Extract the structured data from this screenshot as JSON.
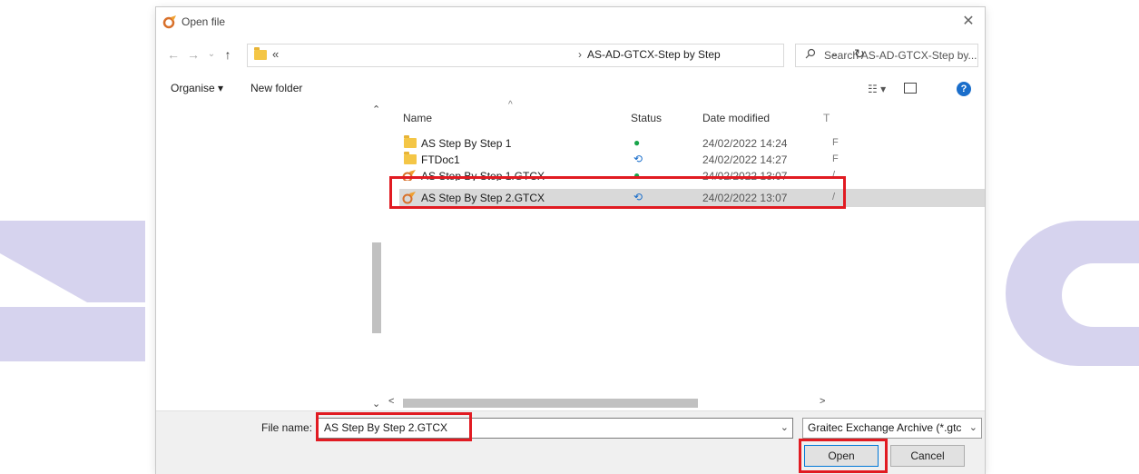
{
  "window": {
    "title": "Open file",
    "close_symbol": "✕"
  },
  "nav": {
    "back": "←",
    "forward": "→",
    "recent": "⌄",
    "up": "↑"
  },
  "address": {
    "overflow_symbol": "«",
    "separator": "›",
    "path": "AS-AD-GTCX-Step by Step",
    "dropdown_symbol": "⌄",
    "refresh_symbol": "↻"
  },
  "search": {
    "placeholder": "Search AS-AD-GTCX-Step by..."
  },
  "toolbar": {
    "organise_label": "Organise ▾",
    "new_folder_label": "New folder",
    "view_symbol": "☷ ▾",
    "help_symbol": "?"
  },
  "columns": {
    "name": "Name",
    "status": "Status",
    "date": "Date modified",
    "more": "T"
  },
  "files": [
    {
      "name": "AS Step By Step 1",
      "type": "folder",
      "status": "ok",
      "date": "24/02/2022 14:24",
      "extra": "F"
    },
    {
      "name": "FTDoc1",
      "type": "folder",
      "status": "sync",
      "date": "24/02/2022 14:27",
      "extra": "F"
    },
    {
      "name": "AS Step By Step 1.GTCX",
      "type": "gtcx",
      "status": "ok",
      "date": "24/02/2022 13:07",
      "extra": "/"
    },
    {
      "name": "AS Step By Step 2.GTCX",
      "type": "gtcx",
      "status": "sync",
      "date": "24/02/2022 13:07",
      "extra": "/",
      "selected": true
    }
  ],
  "status_icons": {
    "ok": "●",
    "sync": "⟲"
  },
  "bottom": {
    "file_name_label": "File name:",
    "file_name_value": "AS Step By Step 2.GTCX",
    "file_type": "Graitec Exchange Archive (*.gtc",
    "open_label": "Open",
    "cancel_label": "Cancel"
  },
  "colors": {
    "highlight": "#e11b22",
    "decoration": "#d6d3ee",
    "selected_row": "#d9d9d9"
  }
}
